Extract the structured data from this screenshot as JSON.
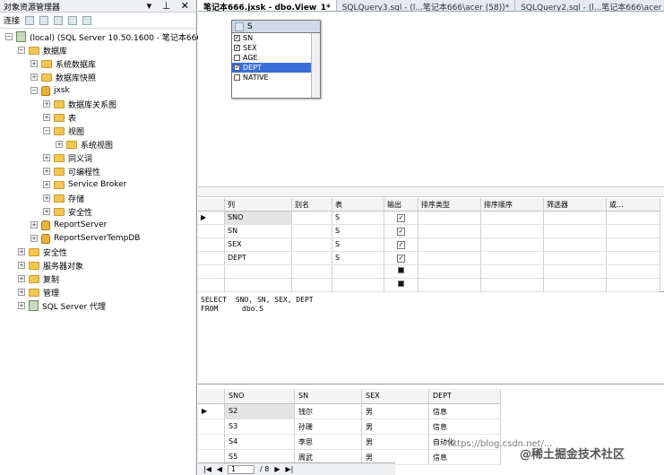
{
  "object_explorer": {
    "title": "对象资源管理器",
    "window_controls": "▾ ⊥ ✕",
    "connect_label": "连接",
    "tree": [
      {
        "label": "(local) (SQL Server 10.50.1600 - 笔记本666",
        "level": 0,
        "icon": "server",
        "pm": "−"
      },
      {
        "label": "数据库",
        "level": 1,
        "icon": "folder",
        "pm": "−"
      },
      {
        "label": "系统数据库",
        "level": 2,
        "icon": "folder",
        "pm": "+"
      },
      {
        "label": "数据库快照",
        "level": 2,
        "icon": "folder",
        "pm": "+"
      },
      {
        "label": "jxsk",
        "level": 2,
        "icon": "database",
        "pm": "−"
      },
      {
        "label": "数据库关系图",
        "level": 3,
        "icon": "folder",
        "pm": "+"
      },
      {
        "label": "表",
        "level": 3,
        "icon": "folder",
        "pm": "+"
      },
      {
        "label": "视图",
        "level": 3,
        "icon": "folder",
        "pm": "−"
      },
      {
        "label": "系统视图",
        "level": 4,
        "icon": "folder",
        "pm": "+"
      },
      {
        "label": "同义词",
        "level": 3,
        "icon": "folder",
        "pm": "+"
      },
      {
        "label": "可编程性",
        "level": 3,
        "icon": "folder",
        "pm": "+"
      },
      {
        "label": "Service Broker",
        "level": 3,
        "icon": "folder",
        "pm": "+"
      },
      {
        "label": "存储",
        "level": 3,
        "icon": "folder",
        "pm": "+"
      },
      {
        "label": "安全性",
        "level": 3,
        "icon": "folder",
        "pm": "+"
      },
      {
        "label": "ReportServer",
        "level": 2,
        "icon": "database",
        "pm": "+"
      },
      {
        "label": "ReportServerTempDB",
        "level": 2,
        "icon": "database",
        "pm": "+"
      },
      {
        "label": "安全性",
        "level": 1,
        "icon": "folder",
        "pm": "+"
      },
      {
        "label": "服务器对象",
        "level": 1,
        "icon": "folder",
        "pm": "+"
      },
      {
        "label": "复制",
        "level": 1,
        "icon": "folder",
        "pm": "+"
      },
      {
        "label": "管理",
        "level": 1,
        "icon": "folder",
        "pm": "+"
      },
      {
        "label": "SQL Server 代理",
        "level": 1,
        "icon": "agent",
        "pm": "+"
      }
    ]
  },
  "tabs": [
    {
      "label": "笔记本666.jxsk - dbo.View_1*",
      "active": true
    },
    {
      "label": "SQLQuery3.sql - (l...笔记本666\\acer (58))*",
      "active": false
    },
    {
      "label": "SQLQuery2.sql - (l...笔记本666\\acer (51))",
      "active": false
    }
  ],
  "table_widget": {
    "name": "S",
    "columns": [
      {
        "name": "SN",
        "checked": true,
        "selected": false
      },
      {
        "name": "SEX",
        "checked": true,
        "selected": false
      },
      {
        "name": "AGE",
        "checked": false,
        "selected": false
      },
      {
        "name": "DEPT",
        "checked": true,
        "selected": true
      },
      {
        "name": "NATIVE",
        "checked": false,
        "selected": false
      }
    ]
  },
  "criteria_grid": {
    "headers": [
      "列",
      "别名",
      "表",
      "输出",
      "排序类型",
      "排序顺序",
      "筛选器",
      "或..."
    ],
    "rows": [
      {
        "col": "SNO",
        "alias": "",
        "table": "S",
        "output": "check"
      },
      {
        "col": "SN",
        "alias": "",
        "table": "S",
        "output": "check"
      },
      {
        "col": "SEX",
        "alias": "",
        "table": "S",
        "output": "check"
      },
      {
        "col": "DEPT",
        "alias": "",
        "table": "S",
        "output": "check"
      },
      {
        "col": "",
        "alias": "",
        "table": "",
        "output": "filled"
      },
      {
        "col": "",
        "alias": "",
        "table": "",
        "output": "filled"
      }
    ]
  },
  "sql": {
    "line1_kw": "SELECT",
    "line1_rest": "SNO, SN, SEX, DEPT",
    "line2_kw": "FROM",
    "line2_rest": "dbo.S"
  },
  "results": {
    "headers": [
      "SNO",
      "SN",
      "SEX",
      "DEPT"
    ],
    "rows": [
      [
        "S2",
        "钱尔",
        "男",
        "信息"
      ],
      [
        "S3",
        "孙珊",
        "男",
        "信息"
      ],
      [
        "S4",
        "李思",
        "男",
        "自动化"
      ],
      [
        "S5",
        "周武",
        "男",
        "信息"
      ]
    ]
  },
  "pager": {
    "current": "1",
    "total": "/ 8"
  },
  "watermark": {
    "url": "https://blog.csdn.net/...",
    "brand": "@稀土掘金技术社区"
  }
}
